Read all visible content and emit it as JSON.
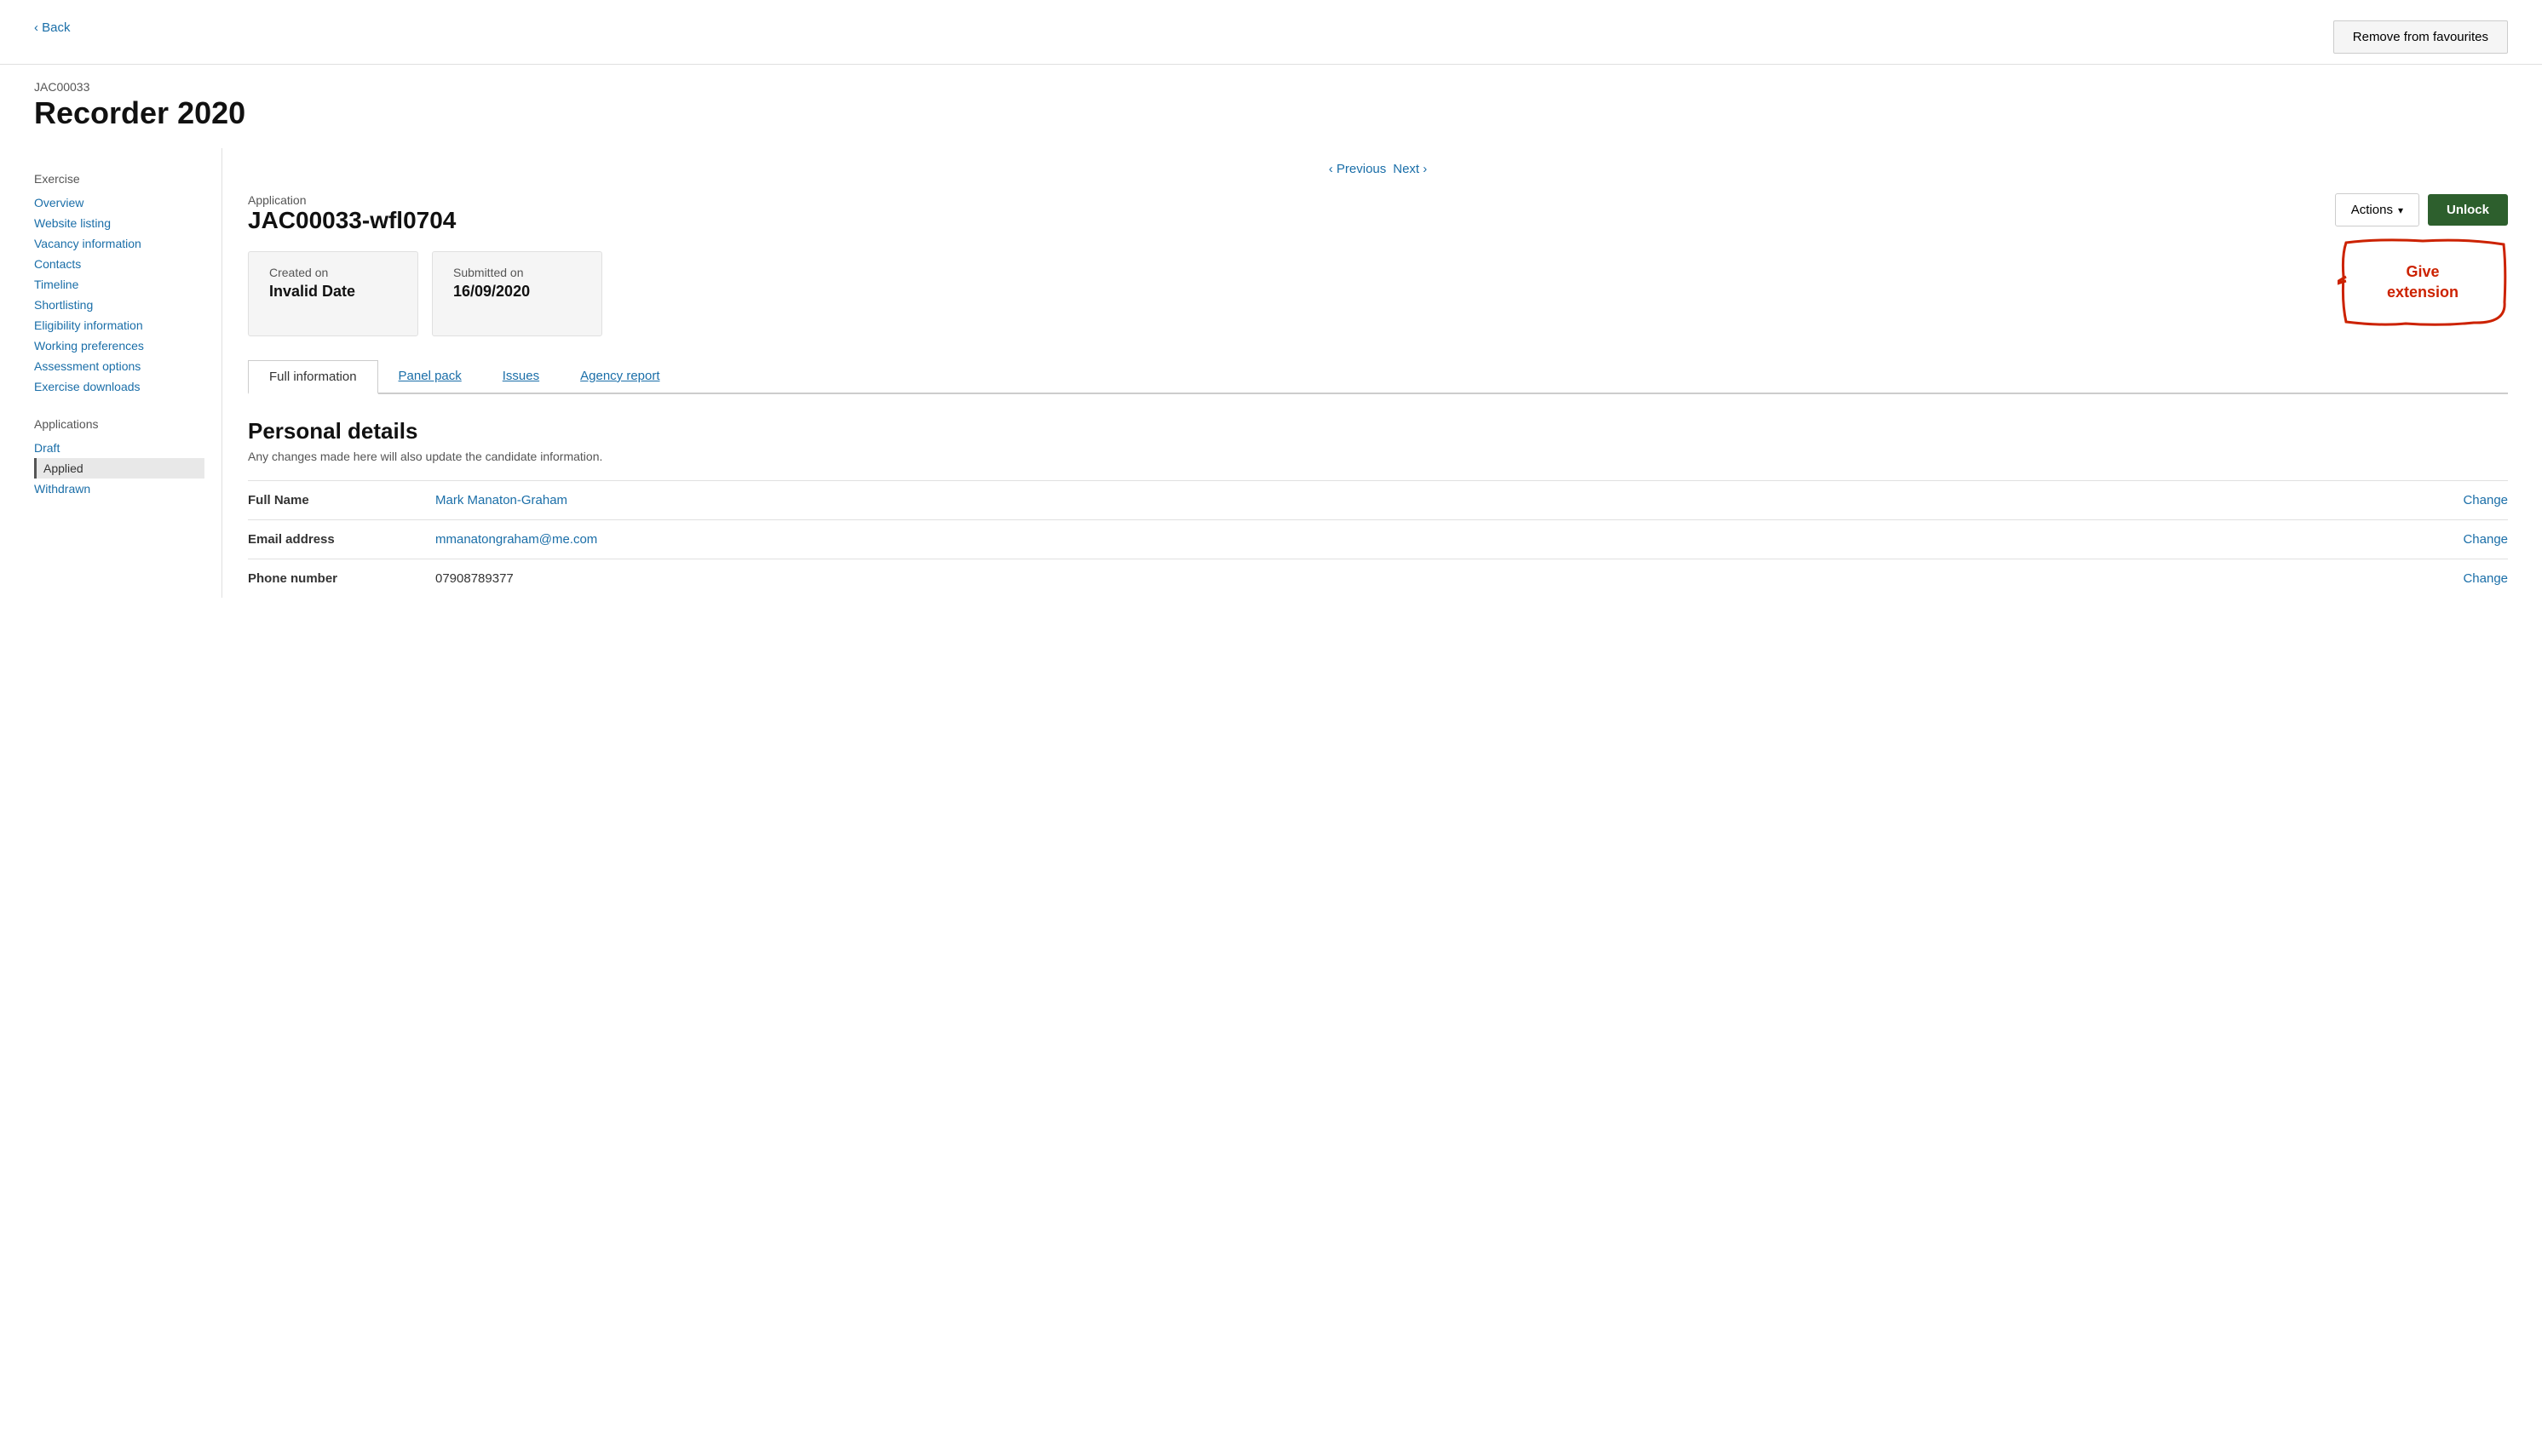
{
  "header": {
    "back_label": "Back",
    "remove_fav_label": "Remove from favourites"
  },
  "page": {
    "subtitle": "JAC00033",
    "title": "Recorder 2020"
  },
  "sidebar": {
    "exercise_label": "Exercise",
    "exercise_links": [
      {
        "id": "overview",
        "label": "Overview",
        "active": false
      },
      {
        "id": "website-listing",
        "label": "Website listing",
        "active": false
      },
      {
        "id": "vacancy-information",
        "label": "Vacancy information",
        "active": false
      },
      {
        "id": "contacts",
        "label": "Contacts",
        "active": false
      },
      {
        "id": "timeline",
        "label": "Timeline",
        "active": false
      },
      {
        "id": "shortlisting",
        "label": "Shortlisting",
        "active": false
      },
      {
        "id": "eligibility-information",
        "label": "Eligibility information",
        "active": false
      },
      {
        "id": "working-preferences",
        "label": "Working preferences",
        "active": false
      },
      {
        "id": "assessment-options",
        "label": "Assessment options",
        "active": false
      },
      {
        "id": "exercise-downloads",
        "label": "Exercise downloads",
        "active": false
      }
    ],
    "applications_label": "Applications",
    "application_links": [
      {
        "id": "draft",
        "label": "Draft",
        "active": false
      },
      {
        "id": "applied",
        "label": "Applied",
        "active": true
      },
      {
        "id": "withdrawn",
        "label": "Withdrawn",
        "active": false
      }
    ]
  },
  "pagination": {
    "previous_label": "Previous",
    "next_label": "Next"
  },
  "application": {
    "label": "Application",
    "id": "JAC00033-wfl0704",
    "actions_label": "Actions",
    "unlock_label": "Unlock"
  },
  "info_cards": {
    "created_label": "Created on",
    "created_value": "Invalid Date",
    "submitted_label": "Submitted on",
    "submitted_value": "16/09/2020",
    "annotation_label": "Give extension"
  },
  "tabs": [
    {
      "id": "full-information",
      "label": "Full information",
      "active": true
    },
    {
      "id": "panel-pack",
      "label": "Panel pack",
      "active": false
    },
    {
      "id": "issues",
      "label": "Issues",
      "active": false
    },
    {
      "id": "agency-report",
      "label": "Agency report",
      "active": false
    }
  ],
  "personal_details": {
    "section_title": "Personal details",
    "section_subtitle": "Any changes made here will also update the candidate information.",
    "rows": [
      {
        "label": "Full Name",
        "value": "Mark Manaton-Graham",
        "value_is_link": true,
        "change_label": "Change"
      },
      {
        "label": "Email address",
        "value": "mmanatongraham@me.com",
        "value_is_link": true,
        "change_label": "Change"
      },
      {
        "label": "Phone number",
        "value": "07908789377",
        "value_is_link": false,
        "change_label": "Change"
      }
    ]
  }
}
